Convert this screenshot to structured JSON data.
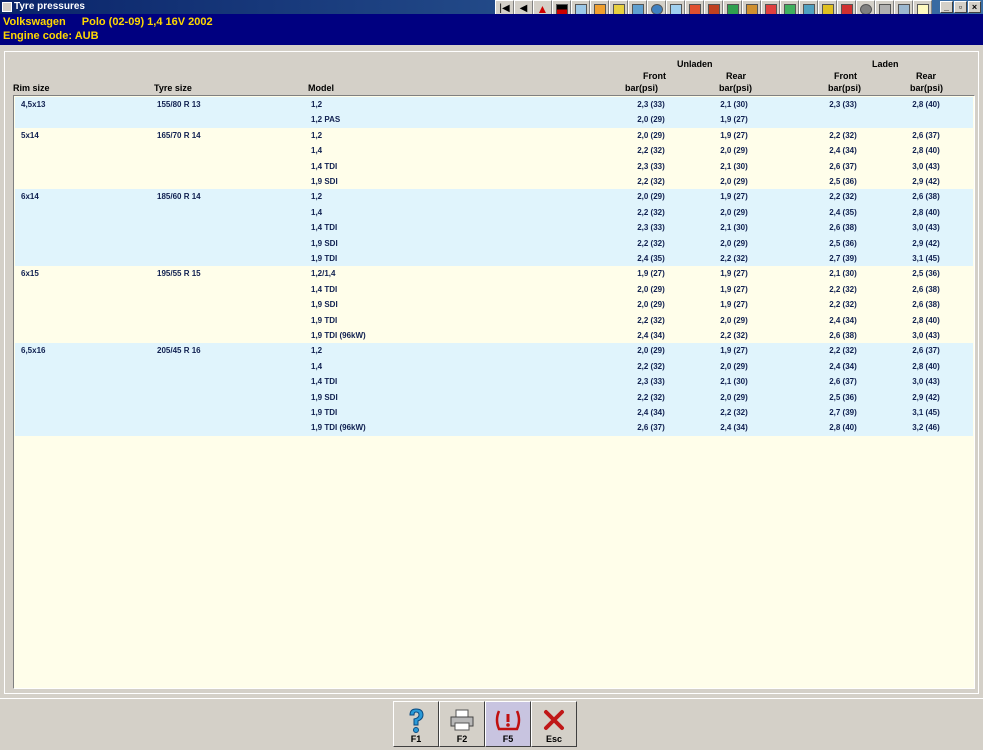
{
  "window": {
    "title": "Tyre pressures"
  },
  "vehicle": {
    "make": "Volkswagen",
    "model": "Polo (02-09) 1,4 16V 2002",
    "engine_code": "Engine code: AUB"
  },
  "columns": {
    "rim": "Rim size",
    "tyre": "Tyre size",
    "model": "Model",
    "unladen": "Unladen",
    "laden": "Laden",
    "front": "Front",
    "rear": "Rear",
    "unit": "bar(psi)"
  },
  "rows": [
    {
      "rim": "4,5x13",
      "tyre": "155/80 R 13",
      "model": "1,2",
      "uf": "2,3 (33)",
      "ur": "2,1 (30)",
      "lf": "2,3 (33)",
      "lr": "2,8 (40)",
      "shade": "blue"
    },
    {
      "rim": "",
      "tyre": "",
      "model": "1,2 PAS",
      "uf": "2,0 (29)",
      "ur": "1,9 (27)",
      "lf": "",
      "lr": "",
      "shade": "blue"
    },
    {
      "rim": "5x14",
      "tyre": "165/70 R 14",
      "model": "1,2",
      "uf": "2,0 (29)",
      "ur": "1,9 (27)",
      "lf": "2,2 (32)",
      "lr": "2,6 (37)",
      "shade": "cream"
    },
    {
      "rim": "",
      "tyre": "",
      "model": "1,4",
      "uf": "2,2 (32)",
      "ur": "2,0 (29)",
      "lf": "2,4 (34)",
      "lr": "2,8 (40)",
      "shade": "cream"
    },
    {
      "rim": "",
      "tyre": "",
      "model": "1,4 TDI",
      "uf": "2,3 (33)",
      "ur": "2,1 (30)",
      "lf": "2,6 (37)",
      "lr": "3,0 (43)",
      "shade": "cream"
    },
    {
      "rim": "",
      "tyre": "",
      "model": "1,9 SDI",
      "uf": "2,2 (32)",
      "ur": "2,0 (29)",
      "lf": "2,5 (36)",
      "lr": "2,9 (42)",
      "shade": "cream"
    },
    {
      "rim": "6x14",
      "tyre": "185/60 R 14",
      "model": "1,2",
      "uf": "2,0 (29)",
      "ur": "1,9 (27)",
      "lf": "2,2 (32)",
      "lr": "2,6 (38)",
      "shade": "blue"
    },
    {
      "rim": "",
      "tyre": "",
      "model": "1,4",
      "uf": "2,2 (32)",
      "ur": "2,0 (29)",
      "lf": "2,4 (35)",
      "lr": "2,8 (40)",
      "shade": "blue"
    },
    {
      "rim": "",
      "tyre": "",
      "model": "1,4 TDI",
      "uf": "2,3 (33)",
      "ur": "2,1 (30)",
      "lf": "2,6 (38)",
      "lr": "3,0 (43)",
      "shade": "blue"
    },
    {
      "rim": "",
      "tyre": "",
      "model": "1,9 SDI",
      "uf": "2,2 (32)",
      "ur": "2,0 (29)",
      "lf": "2,5 (36)",
      "lr": "2,9 (42)",
      "shade": "blue"
    },
    {
      "rim": "",
      "tyre": "",
      "model": "1,9 TDI",
      "uf": "2,4 (35)",
      "ur": "2,2 (32)",
      "lf": "2,7 (39)",
      "lr": "3,1 (45)",
      "shade": "blue"
    },
    {
      "rim": "6x15",
      "tyre": "195/55 R 15",
      "model": "1,2/1,4",
      "uf": "1,9 (27)",
      "ur": "1,9 (27)",
      "lf": "2,1 (30)",
      "lr": "2,5 (36)",
      "shade": "cream"
    },
    {
      "rim": "",
      "tyre": "",
      "model": "1,4 TDI",
      "uf": "2,0 (29)",
      "ur": "1,9 (27)",
      "lf": "2,2 (32)",
      "lr": "2,6 (38)",
      "shade": "cream"
    },
    {
      "rim": "",
      "tyre": "",
      "model": "1,9 SDI",
      "uf": "2,0 (29)",
      "ur": "1,9 (27)",
      "lf": "2,2 (32)",
      "lr": "2,6 (38)",
      "shade": "cream"
    },
    {
      "rim": "",
      "tyre": "",
      "model": "1,9 TDI",
      "uf": "2,2 (32)",
      "ur": "2,0 (29)",
      "lf": "2,4 (34)",
      "lr": "2,8 (40)",
      "shade": "cream"
    },
    {
      "rim": "",
      "tyre": "",
      "model": "1,9 TDI (96kW)",
      "uf": "2,4 (34)",
      "ur": "2,2 (32)",
      "lf": "2,6 (38)",
      "lr": "3,0 (43)",
      "shade": "cream"
    },
    {
      "rim": "6,5x16",
      "tyre": "205/45 R 16",
      "model": "1,2",
      "uf": "2,0 (29)",
      "ur": "1,9 (27)",
      "lf": "2,2 (32)",
      "lr": "2,6 (37)",
      "shade": "blue"
    },
    {
      "rim": "",
      "tyre": "",
      "model": "1,4",
      "uf": "2,2 (32)",
      "ur": "2,0 (29)",
      "lf": "2,4 (34)",
      "lr": "2,8 (40)",
      "shade": "blue"
    },
    {
      "rim": "",
      "tyre": "",
      "model": "1,4 TDI",
      "uf": "2,3 (33)",
      "ur": "2,1 (30)",
      "lf": "2,6 (37)",
      "lr": "3,0 (43)",
      "shade": "blue"
    },
    {
      "rim": "",
      "tyre": "",
      "model": "1,9 SDI",
      "uf": "2,2 (32)",
      "ur": "2,0 (29)",
      "lf": "2,5 (36)",
      "lr": "2,9 (42)",
      "shade": "blue"
    },
    {
      "rim": "",
      "tyre": "",
      "model": "1,9 TDI",
      "uf": "2,4 (34)",
      "ur": "2,2 (32)",
      "lf": "2,7 (39)",
      "lr": "3,1 (45)",
      "shade": "blue"
    },
    {
      "rim": "",
      "tyre": "",
      "model": "1,9 TDI (96kW)",
      "uf": "2,6 (37)",
      "ur": "2,4 (34)",
      "lf": "2,8 (40)",
      "lr": "3,2 (46)",
      "shade": "blue"
    }
  ],
  "function_keys": [
    {
      "label": "F1",
      "icon": "help-icon"
    },
    {
      "label": "F2",
      "icon": "printer-icon"
    },
    {
      "label": "F5",
      "icon": "tyre-pressure-warning-icon"
    },
    {
      "label": "Esc",
      "icon": "close-icon"
    }
  ],
  "colors": {
    "row_blue": "#e0f4fc",
    "row_cream": "#fffeea",
    "vehicle_bg": "#000080",
    "vehicle_text": "#ffd800"
  }
}
